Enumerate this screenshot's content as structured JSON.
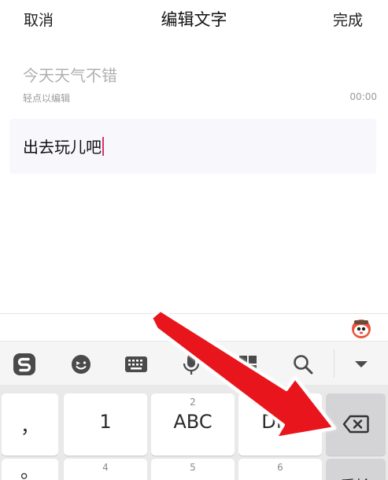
{
  "header": {
    "cancel": "取消",
    "title": "编辑文字",
    "done": "完成"
  },
  "original": {
    "text": "今天天气不错",
    "hint": "轻点以编辑",
    "time": "00:00"
  },
  "editor": {
    "value": "出去玩儿吧"
  },
  "keyboard": {
    "toolbar_icons": [
      "sogou-logo-icon",
      "emoji-icon",
      "keyboard-icon",
      "microphone-icon",
      "clipboard-icon",
      "search-icon",
      "collapse-icon"
    ],
    "left_keys": [
      "，",
      "。"
    ],
    "row1": [
      {
        "num": "",
        "label": "1"
      },
      {
        "num": "2",
        "label": "ABC"
      },
      {
        "num": "",
        "label": "DEF"
      }
    ],
    "row2_nums": [
      "4",
      "5",
      "6"
    ],
    "row2_partial": [
      "重输"
    ]
  },
  "colors": {
    "accent_caret": "#d6356e",
    "arrow_red": "#e8141b",
    "sogou_red": "#e5362c"
  }
}
